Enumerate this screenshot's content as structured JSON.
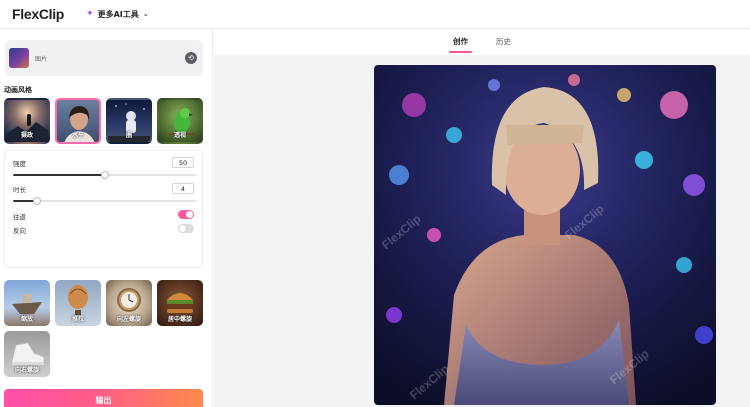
{
  "app": {
    "logo_text": "FlexClip",
    "tools_menu_label": "更多AI工具"
  },
  "upload": {
    "label": "图片"
  },
  "style_section": {
    "title": "动画风格",
    "items": [
      {
        "label": "摄政",
        "selected": false
      },
      {
        "label": "水平",
        "selected": true
      },
      {
        "label": "圈",
        "selected": false
      },
      {
        "label": "透视",
        "selected": false
      }
    ]
  },
  "settings": {
    "strength": {
      "label": "强度",
      "value": "50",
      "fraction": 0.5
    },
    "duration": {
      "label": "时长",
      "value": "4",
      "fraction": 0.13
    },
    "loop": {
      "label": "往返",
      "on": true
    },
    "reverse": {
      "label": "反向",
      "on": false
    }
  },
  "motions": [
    {
      "label": "缩放"
    },
    {
      "label": "推拉"
    },
    {
      "label": "向左螺旋"
    },
    {
      "label": "居中螺旋"
    },
    {
      "label": "向右螺旋"
    }
  ],
  "export_label": "输出",
  "tabs": [
    {
      "label": "创作",
      "active": true
    },
    {
      "label": "历史",
      "active": false
    }
  ],
  "preview": {
    "watermark": "FlexClip"
  },
  "colors": {
    "accent": "#ff4f8d",
    "export_start": "#ff4fa8",
    "export_end": "#ff8a4c"
  }
}
